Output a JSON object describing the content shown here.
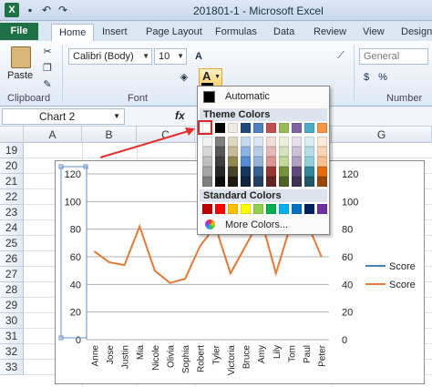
{
  "window": {
    "title": "201801-1  -  Microsoft Excel",
    "app_icon": "X"
  },
  "tabs": [
    "File",
    "Home",
    "Insert",
    "Page Layout",
    "Formulas",
    "Data",
    "Review",
    "View",
    "Design"
  ],
  "ribbon": {
    "clipboard": {
      "paste_label": "Paste",
      "group_label": "Clipboard"
    },
    "font": {
      "name": "Calibri (Body)",
      "size": "10",
      "group_label": "Font",
      "font_color_glyph": "A"
    },
    "number": {
      "format": "General",
      "group_label": "Number"
    }
  },
  "formula_bar": {
    "name_box": "Chart 2",
    "fx_label": "fx"
  },
  "grid": {
    "columns": [
      "A",
      "B",
      "C",
      "G"
    ],
    "rows": [
      "19",
      "20",
      "21",
      "22",
      "23",
      "24",
      "25",
      "26",
      "27",
      "28",
      "29",
      "30",
      "31",
      "32",
      "33"
    ]
  },
  "font_color_menu": {
    "automatic": "Automatic",
    "theme_colors": "Theme Colors",
    "standard_colors": "Standard Colors",
    "more_colors": "More Colors...",
    "theme_top": [
      "#ffffff",
      "#000000",
      "#eeece1",
      "#1f497d",
      "#4f81bd",
      "#c0504d",
      "#9bbb59",
      "#8064a2",
      "#4bacc6",
      "#f79646"
    ],
    "theme_shades": [
      [
        "#f2f2f2",
        "#7f7f7f",
        "#ddd9c3",
        "#c6d9f0",
        "#dbe5f1",
        "#f2dcdb",
        "#ebf1dd",
        "#e5e0ec",
        "#dbeef3",
        "#fdeada"
      ],
      [
        "#d8d8d8",
        "#595959",
        "#c4bd97",
        "#8db3e2",
        "#b8cce4",
        "#e5b9b7",
        "#d7e3bc",
        "#ccc1d9",
        "#b7dde8",
        "#fbd5b5"
      ],
      [
        "#bfbfbf",
        "#3f3f3f",
        "#938953",
        "#548dd4",
        "#95b3d7",
        "#d99694",
        "#c3d69b",
        "#b2a2c7",
        "#92cddc",
        "#fac08f"
      ],
      [
        "#a5a5a5",
        "#262626",
        "#494429",
        "#17365d",
        "#366092",
        "#953734",
        "#76923c",
        "#5f497a",
        "#31859b",
        "#e36c09"
      ],
      [
        "#7f7f7f",
        "#0c0c0c",
        "#1d1b10",
        "#0f243e",
        "#244061",
        "#632423",
        "#4f6128",
        "#3f3151",
        "#205867",
        "#974806"
      ]
    ],
    "standard": [
      "#c00000",
      "#ff0000",
      "#ffc000",
      "#ffff00",
      "#92d050",
      "#00b050",
      "#00b0f0",
      "#0070c0",
      "#002060",
      "#7030a0"
    ]
  },
  "chart_data": {
    "type": "line",
    "categories": [
      "Anne",
      "Jose",
      "Justin",
      "Mia",
      "Nicole",
      "Olivia",
      "Sophia",
      "Robert",
      "Tyler",
      "Victoria",
      "Bruce",
      "Amy",
      "Lily",
      "Tom",
      "Paul",
      "Peter"
    ],
    "series": [
      {
        "name": "Score",
        "color": "#4a7ebb",
        "values": []
      },
      {
        "name": "Score",
        "color": "#e07b39",
        "values": [
          64,
          56,
          54,
          82,
          50,
          41,
          44,
          68,
          82,
          48,
          68,
          88,
          48,
          84,
          86,
          60
        ]
      }
    ],
    "left_axis_ticks": [
      "0",
      "20",
      "40",
      "60",
      "80",
      "100",
      "120"
    ],
    "right_axis_ticks": [
      "0",
      "20",
      "40",
      "60",
      "80",
      "100",
      "120"
    ],
    "ylim": [
      0,
      120
    ],
    "grid": true,
    "legend_position": "right"
  }
}
